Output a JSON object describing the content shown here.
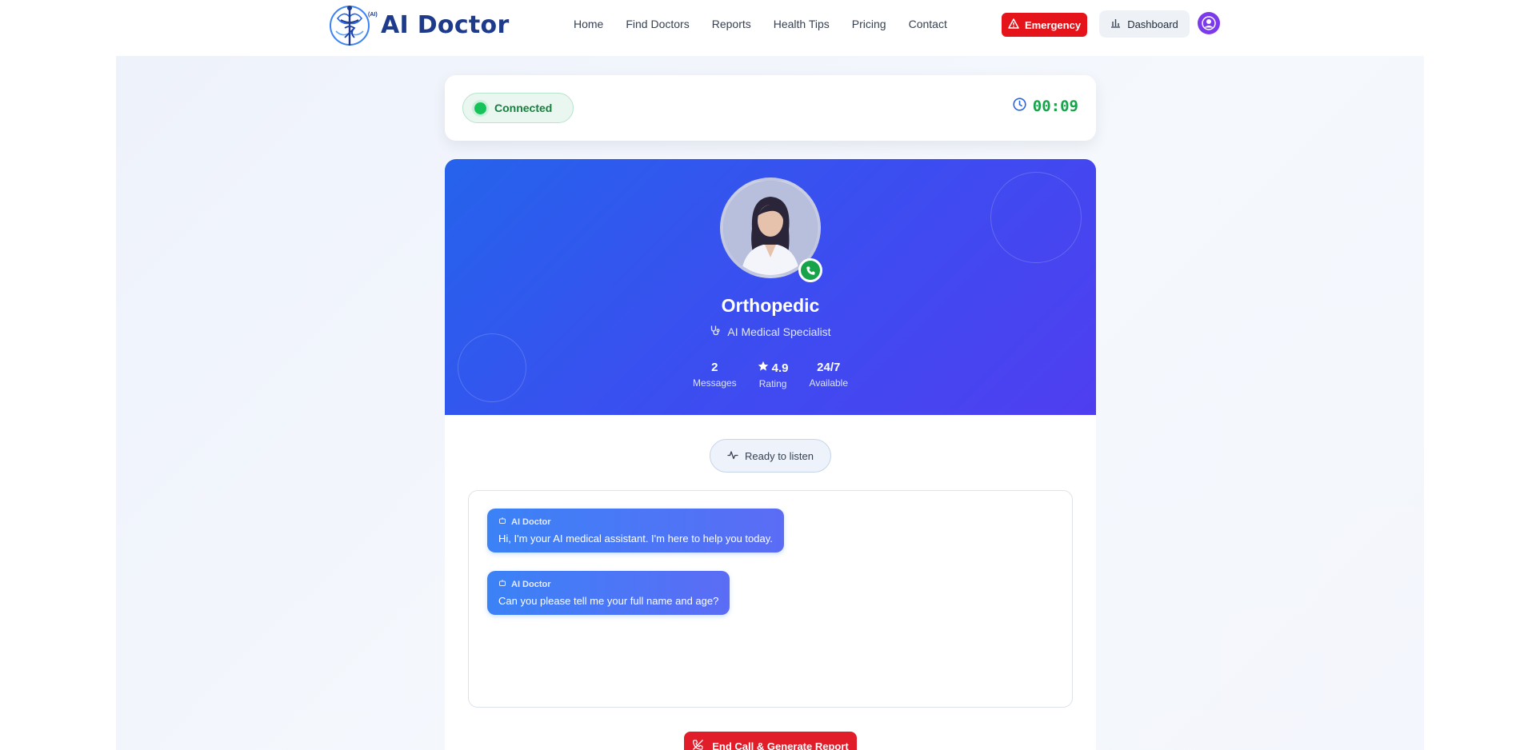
{
  "header": {
    "logo_text": "AI Doctor",
    "logo_badge": "(AI)",
    "nav": [
      "Home",
      "Find Doctors",
      "Reports",
      "Health Tips",
      "Pricing",
      "Contact"
    ],
    "emergency_label": "Emergency",
    "dashboard_label": "Dashboard"
  },
  "status": {
    "connection_label": "Connected",
    "timer": "00:09"
  },
  "doctor": {
    "name": "Orthopedic",
    "role": "AI Medical Specialist",
    "stats": [
      {
        "value": "2",
        "label": "Messages"
      },
      {
        "value": "4.9",
        "label": "Rating"
      },
      {
        "value": "24/7",
        "label": "Available"
      }
    ]
  },
  "listen_status": "Ready to listen",
  "messages": [
    {
      "sender": "AI Doctor",
      "text": "Hi, I'm your AI medical assistant. I'm here to help you today."
    },
    {
      "sender": "AI Doctor",
      "text": "Can you please tell me your full name and age?"
    }
  ],
  "end_call_label": "End Call & Generate Report",
  "colors": {
    "primary": "#2563eb",
    "secondary": "#4f3ef0",
    "danger": "#e4141a",
    "success": "#16a34a"
  }
}
